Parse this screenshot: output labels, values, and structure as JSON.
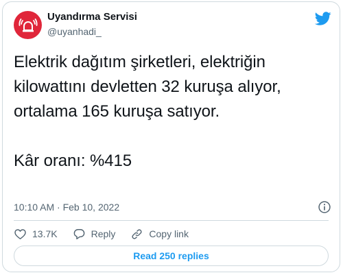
{
  "author": {
    "name": "Uyandırma Servisi",
    "handle": "@uyanhadi_"
  },
  "tweet": {
    "lines": [
      "Elektrik dağıtım şirketleri, elektriğin",
      "kilowattını devletten 32 kuruşa alıyor,",
      "ortalama 165 kuruşa satıyor.",
      "Kâr oranı: %415"
    ],
    "timestamp": "10:10 AM · Feb 10, 2022"
  },
  "actions": {
    "likes": "13.7K",
    "reply_label": "Reply",
    "copy_link_label": "Copy link"
  },
  "read_replies_label": "Read 250 replies",
  "colors": {
    "avatar_bg": "#e0263a",
    "accent": "#1d9bf0",
    "border": "#cfd9de",
    "secondary_text": "#536471"
  },
  "icons": {
    "avatar": "alarm-siren-icon",
    "brand": "twitter-bird-icon",
    "info": "info-icon",
    "like": "heart-icon",
    "reply": "reply-bubble-icon",
    "copy_link": "link-icon"
  }
}
